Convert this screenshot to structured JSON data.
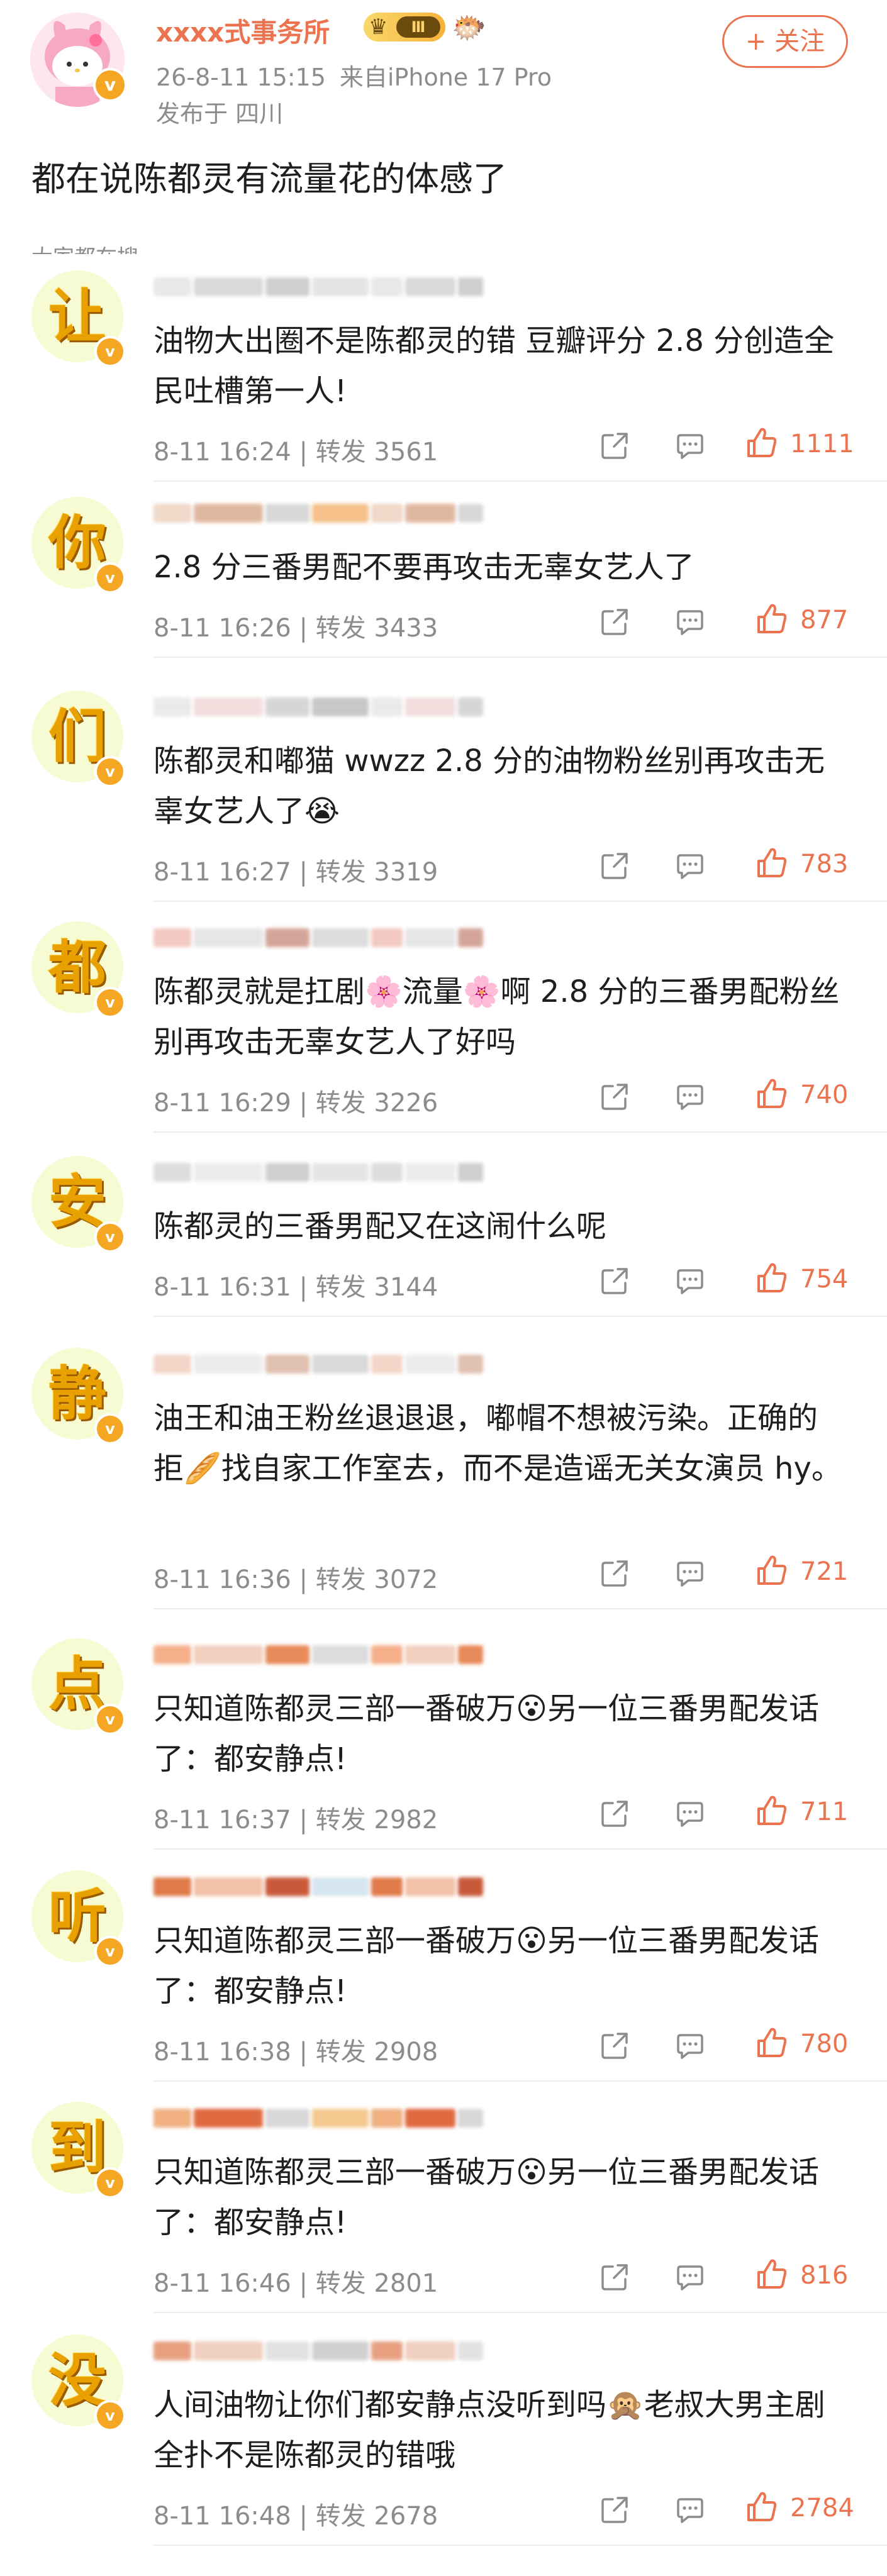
{
  "post": {
    "author": "xxxx式事务所",
    "level_badge": "Ⅲ",
    "time": "26-8-11 15:15",
    "source": "来自iPhone 17 Pro",
    "location": "发布于 四川",
    "follow_label": "+ 关注",
    "text": "都在说陈都灵有流量花的体感了",
    "section_label": "大家都在搜"
  },
  "comments": [
    {
      "avatar_char": "让",
      "body": "油物大出圈不是陈都灵的错  豆瓣评分 2.8 分创造全民吐槽第一人!",
      "time": "8-11 16:24 | 转发 3561",
      "likes": "1111"
    },
    {
      "avatar_char": "你",
      "body": "2.8 分三番男配不要再攻击无辜女艺人了",
      "time": "8-11 16:26 | 转发 3433",
      "likes": "877"
    },
    {
      "avatar_char": "们",
      "body": "陈都灵和嘟猫 wwzz  2.8 分的油物粉丝别再攻击无辜女艺人了😭",
      "time": "8-11 16:27 | 转发 3319",
      "likes": "783"
    },
    {
      "avatar_char": "都",
      "body": "陈都灵就是扛剧🌸流量🌸啊 2.8 分的三番男配粉丝别再攻击无辜女艺人了好吗",
      "time": "8-11 16:29 | 转发 3226",
      "likes": "740"
    },
    {
      "avatar_char": "安",
      "body": "陈都灵的三番男配又在这闹什么呢",
      "time": "8-11 16:31 | 转发 3144",
      "likes": "754"
    },
    {
      "avatar_char": "静",
      "body": "油王和油王粉丝退退退，嘟帽不想被污染。正确的拒🥖找自家工作室去，而不是造谣无关女演员 hy。",
      "time": "8-11 16:36 | 转发 3072",
      "likes": "721"
    },
    {
      "avatar_char": "点",
      "body": "只知道陈都灵三部一番破万😮另一位三番男配发话了：都安静点!",
      "time": "8-11 16:37 | 转发 2982",
      "likes": "711"
    },
    {
      "avatar_char": "听",
      "body": "只知道陈都灵三部一番破万😮另一位三番男配发话了：都安静点!",
      "time": "8-11 16:38 | 转发 2908",
      "likes": "780"
    },
    {
      "avatar_char": "到",
      "body": "只知道陈都灵三部一番破万😮另一位三番男配发话了：都安静点!",
      "time": "8-11 16:46 | 转发 2801",
      "likes": "816"
    },
    {
      "avatar_char": "没",
      "body": "人间油物让你们都安静点没听到吗🙊老叔大男主剧全扑不是陈都灵的错哦",
      "time": "8-11 16:48 | 转发 2678",
      "likes": "2784"
    }
  ],
  "icons": {
    "share": "share-icon",
    "comment": "comment-icon",
    "like": "thumbs-up-icon",
    "vip": "vip-v-icon"
  },
  "colors": {
    "accent": "#eb7350",
    "meta": "#8c8c8c",
    "avatar_bg": "#f6fbd4",
    "avatar_char": "#e8a100",
    "vip": "#f5a623"
  }
}
